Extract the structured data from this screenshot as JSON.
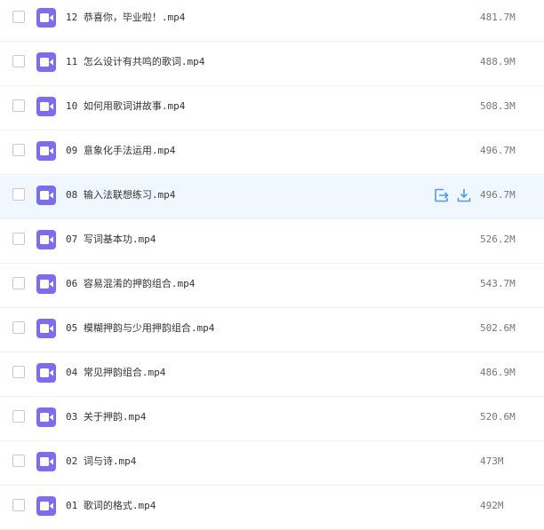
{
  "colors": {
    "video_icon": "#7b6cf0",
    "hover_row": "#f0f7fe",
    "action_icon": "#4a9df0"
  },
  "files": [
    {
      "name": "12 恭喜你，毕业啦！.mp4",
      "size": "481.7M"
    },
    {
      "name": "11 怎么设计有共鸣的歌词.mp4",
      "size": "488.9M"
    },
    {
      "name": "10 如何用歌词讲故事.mp4",
      "size": "508.3M"
    },
    {
      "name": "09 意象化手法运用.mp4",
      "size": "496.7M"
    },
    {
      "name": "08 输入法联想练习.mp4",
      "size": "496.7M",
      "hovered": true,
      "actions": [
        "move-to-icon",
        "download-icon"
      ]
    },
    {
      "name": "07 写词基本功.mp4",
      "size": "526.2M"
    },
    {
      "name": "06 容易混淆的押韵组合.mp4",
      "size": "543.7M"
    },
    {
      "name": "05 模糊押韵与少用押韵组合.mp4",
      "size": "502.6M"
    },
    {
      "name": "04 常见押韵组合.mp4",
      "size": "486.9M"
    },
    {
      "name": "03 关于押韵.mp4",
      "size": "520.6M"
    },
    {
      "name": "02 词与诗.mp4",
      "size": "473M"
    },
    {
      "name": "01 歌词的格式.mp4",
      "size": "492M"
    }
  ]
}
